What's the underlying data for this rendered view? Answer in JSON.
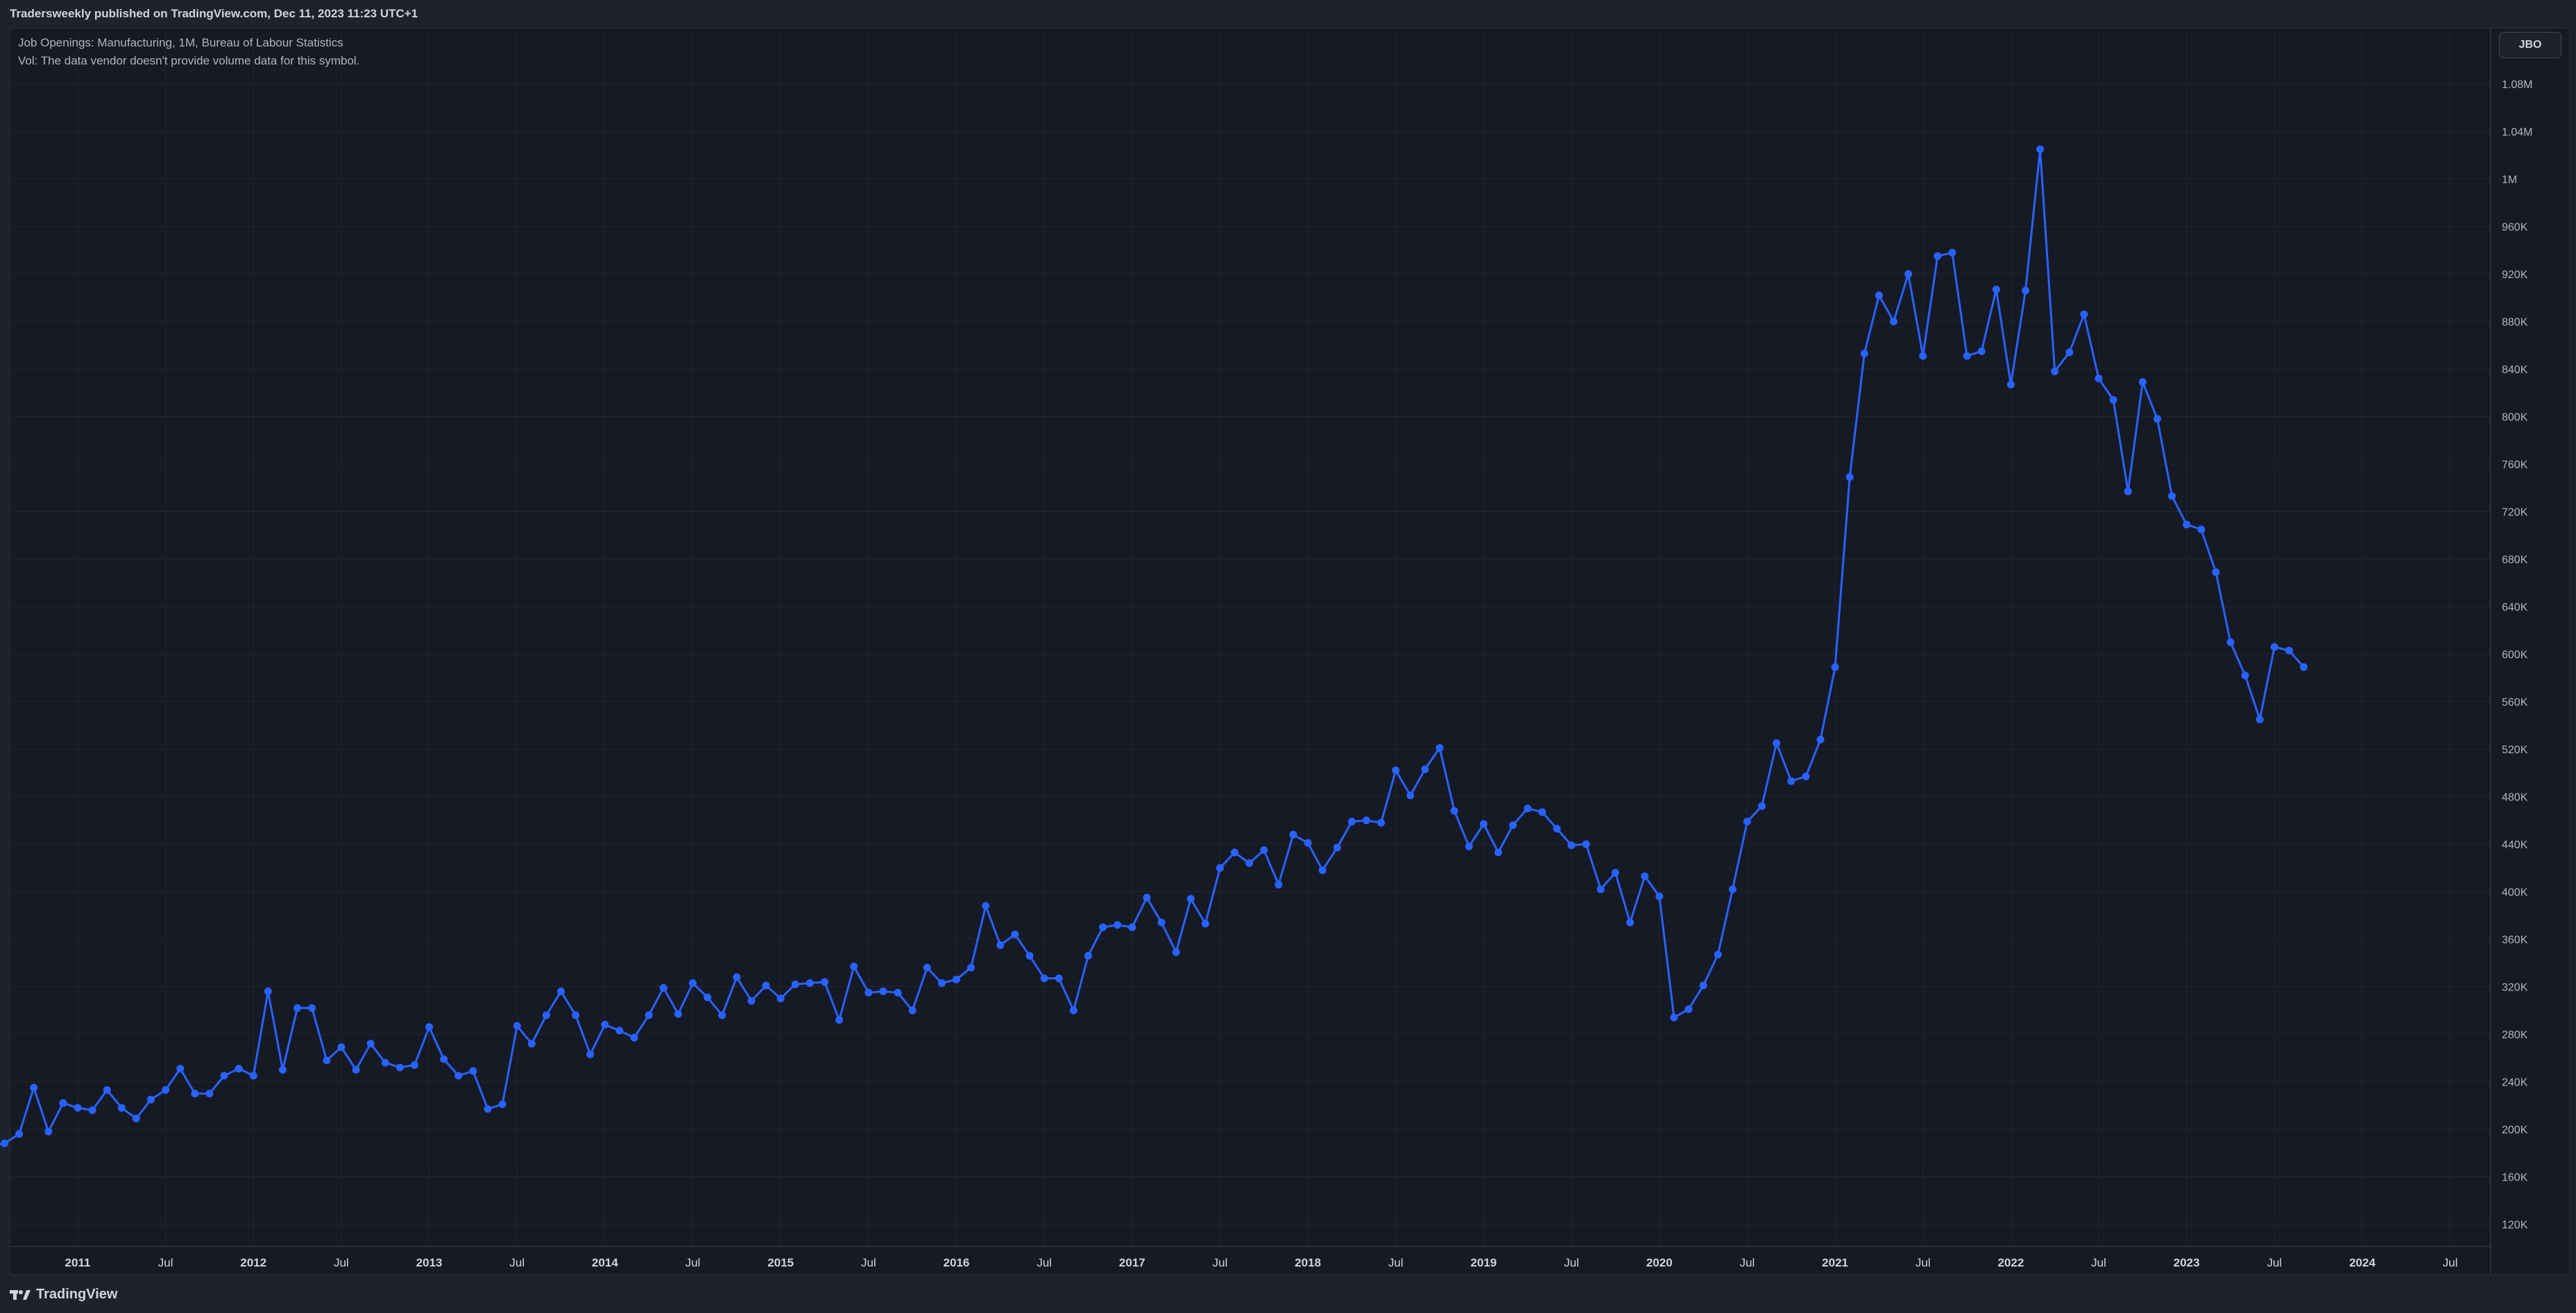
{
  "header": {
    "published_text": "Tradersweekly published on TradingView.com, Dec 11, 2023 11:23 UTC+1"
  },
  "legend": {
    "line1": "Job Openings: Manufacturing, 1M, Bureau of Labour Statistics",
    "line2": "Vol: The data vendor doesn't provide volume data for this symbol."
  },
  "symbol_box": "JBO",
  "footer": {
    "brand": "TradingView"
  },
  "colors": {
    "series": "#2962ff",
    "background": "#161a25",
    "text": "#b2b5be",
    "grid": "#232632"
  },
  "chart_data": {
    "type": "line",
    "title": "",
    "xlabel": "",
    "ylabel": "",
    "ylim": [
      100000,
      1100000
    ],
    "y_ticks": [
      "120K",
      "160K",
      "200K",
      "240K",
      "280K",
      "320K",
      "360K",
      "400K",
      "440K",
      "480K",
      "520K",
      "560K",
      "600K",
      "640K",
      "680K",
      "720K",
      "760K",
      "800K",
      "840K",
      "880K",
      "920K",
      "960K",
      "1M",
      "1.04M",
      "1.08M"
    ],
    "y_tick_values": [
      120000,
      160000,
      200000,
      240000,
      280000,
      320000,
      360000,
      400000,
      440000,
      480000,
      520000,
      560000,
      600000,
      640000,
      680000,
      720000,
      760000,
      800000,
      840000,
      880000,
      920000,
      960000,
      1000000,
      1040000,
      1080000
    ],
    "x_ticks": [
      "2011",
      "Jul",
      "2012",
      "Jul",
      "2013",
      "Jul",
      "2014",
      "Jul",
      "2015",
      "Jul",
      "2016",
      "Jul",
      "2017",
      "Jul",
      "2018",
      "Jul",
      "2019",
      "Jul",
      "2020",
      "Jul",
      "2021",
      "Jul",
      "2022",
      "Jul",
      "2023",
      "Jul",
      "2024",
      "Jul"
    ],
    "x_tick_dates": [
      "2011-01",
      "2011-07",
      "2012-01",
      "2012-07",
      "2013-01",
      "2013-07",
      "2014-01",
      "2014-07",
      "2015-01",
      "2015-07",
      "2016-01",
      "2016-07",
      "2017-01",
      "2017-07",
      "2018-01",
      "2018-07",
      "2019-01",
      "2019-07",
      "2020-01",
      "2020-07",
      "2021-01",
      "2021-07",
      "2022-01",
      "2022-07",
      "2023-01",
      "2023-07",
      "2024-01",
      "2024-07"
    ],
    "x_range": [
      "2010-06",
      "2024-12"
    ],
    "grid": true,
    "series": [
      {
        "start_date": "2010-07",
        "values": [
          186000,
          188000,
          196000,
          235000,
          198000,
          222000,
          218000,
          216000,
          233000,
          218000,
          209000,
          225000,
          233000,
          251000,
          230000,
          230000,
          245000,
          251000,
          245000,
          316000,
          250000,
          302000,
          302000,
          258000,
          269000,
          250000,
          272000,
          256000,
          252000,
          254000,
          286000,
          259000,
          245000,
          249000,
          217000,
          221000,
          287000,
          272000,
          296000,
          316000,
          296000,
          263000,
          288000,
          283000,
          277000,
          296000,
          319000,
          297000,
          323000,
          311000,
          296000,
          328000,
          308000,
          321000,
          310000,
          322000,
          323000,
          324000,
          292000,
          337000,
          315000,
          316000,
          315000,
          300000,
          336000,
          323000,
          326000,
          336000,
          388000,
          355000,
          364000,
          346000,
          327000,
          327000,
          300000,
          346000,
          370000,
          372000,
          370000,
          395000,
          374000,
          349000,
          394000,
          373000,
          420000,
          433000,
          424000,
          435000,
          406000,
          448000,
          441000,
          418000,
          437000,
          459000,
          460000,
          458000,
          502000,
          481000,
          503000,
          521000,
          468000,
          438000,
          457000,
          433000,
          456000,
          470000,
          467000,
          453000,
          439000,
          440000,
          402000,
          416000,
          374000,
          413000,
          396000,
          294000,
          301000,
          321000,
          347000,
          402000,
          459000,
          472000,
          525000,
          493000,
          497000,
          528000,
          589000,
          749000,
          853000,
          902000,
          880000,
          920000,
          851000,
          935000,
          938000,
          851000,
          855000,
          907000,
          827000,
          906000,
          1025000,
          838000,
          854000,
          886000,
          832000,
          814000,
          737000,
          829000,
          798000,
          733000,
          709000,
          705000,
          669000,
          610000,
          582000,
          545000,
          606000,
          603000,
          589000
        ]
      }
    ]
  }
}
